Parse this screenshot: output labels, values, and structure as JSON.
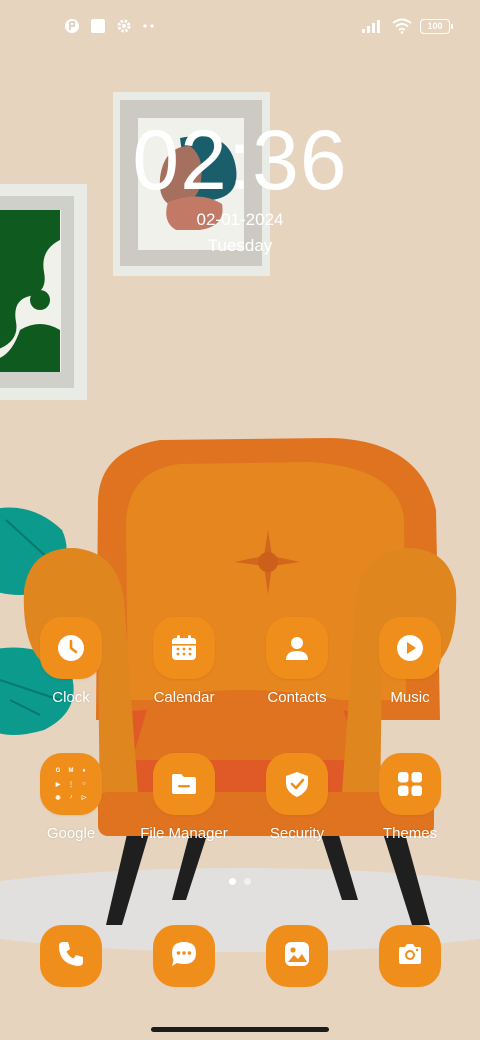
{
  "status_bar": {
    "left_icons": [
      "app-notification-icon",
      "square-notification-icon",
      "settings-gear-icon",
      "more-dots-icon"
    ],
    "right_icons": [
      "signal-icon",
      "wifi-icon"
    ],
    "battery": "100"
  },
  "clock": {
    "time": "02:36",
    "date": "02-01-2024",
    "day": "Tuesday"
  },
  "home_apps": [
    {
      "label": "Clock",
      "icon": "clock-icon"
    },
    {
      "label": "Calendar",
      "icon": "calendar-icon"
    },
    {
      "label": "Contacts",
      "icon": "contact-person-icon"
    },
    {
      "label": "Music",
      "icon": "play-circle-icon"
    },
    {
      "label": "Google",
      "icon": "google-folder-icon"
    },
    {
      "label": "File Manager",
      "icon": "folder-icon"
    },
    {
      "label": "Security",
      "icon": "shield-check-icon"
    },
    {
      "label": "Themes",
      "icon": "grid-tiles-icon"
    }
  ],
  "google_folder_glyphs": [
    "G",
    "M",
    "♦",
    "▶",
    "⋮",
    "○",
    "◉",
    "♪",
    "▷"
  ],
  "page_indicator": {
    "pages": 2,
    "current": 1
  },
  "dock": [
    {
      "icon": "phone-icon"
    },
    {
      "icon": "messages-icon"
    },
    {
      "icon": "gallery-icon"
    },
    {
      "icon": "camera-icon"
    }
  ],
  "colors": {
    "app_icon_bg": "#f08e1b",
    "wallpaper_bg": "#e6d4bf",
    "text": "#ffffff"
  }
}
